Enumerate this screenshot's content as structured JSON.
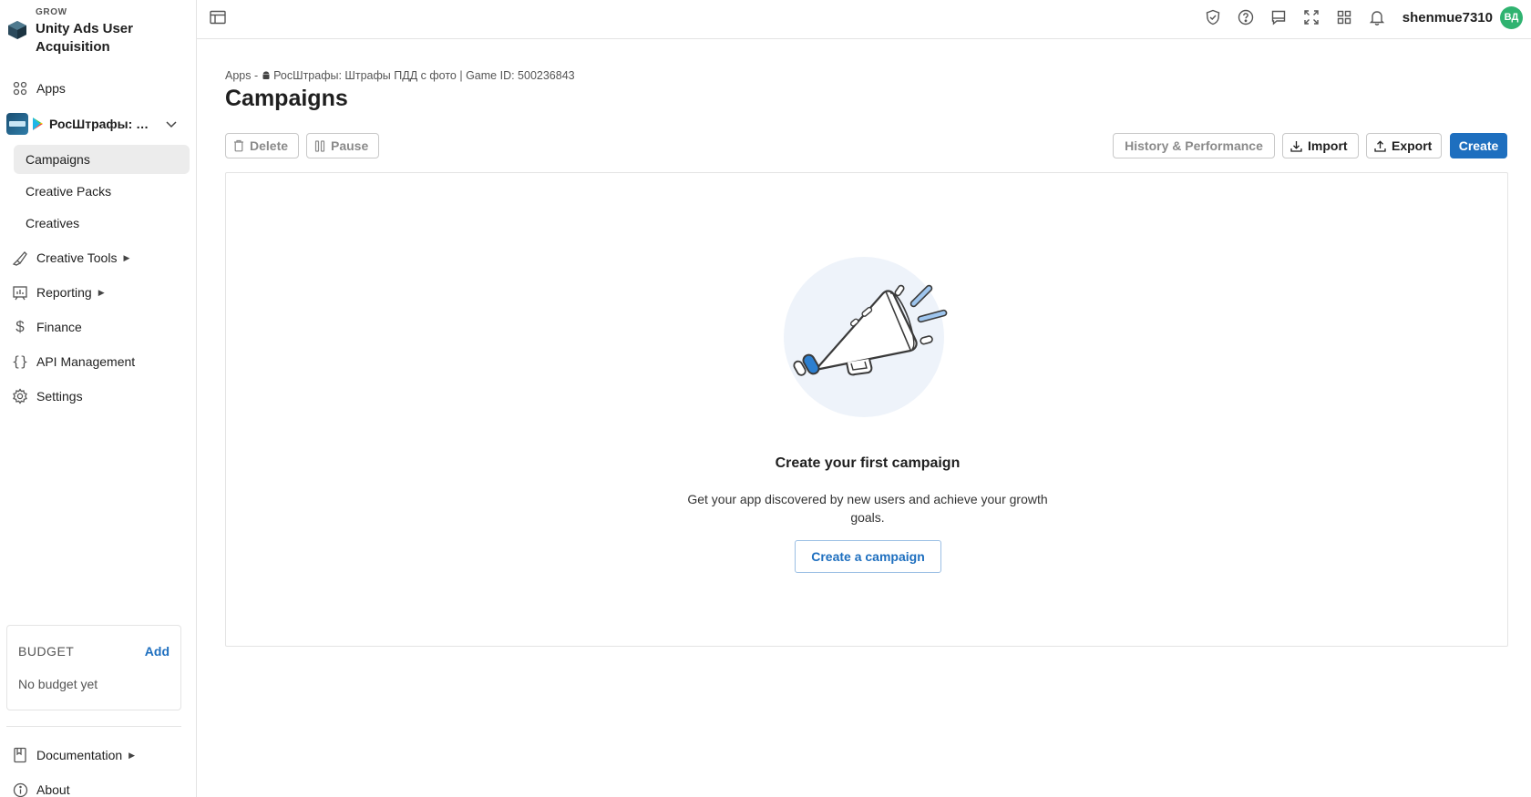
{
  "brand": {
    "eyebrow": "GROW",
    "title": "Unity Ads User Acquisition"
  },
  "sidebar": {
    "apps_label": "Apps",
    "app": {
      "name": "РосШтрафы: Штрафы ПДД с фото"
    },
    "sub_items": [
      {
        "label": "Campaigns",
        "active": true
      },
      {
        "label": "Creative Packs"
      },
      {
        "label": "Creatives"
      }
    ],
    "items": [
      {
        "label": "Creative Tools"
      },
      {
        "label": "Reporting"
      },
      {
        "label": "Finance"
      },
      {
        "label": "API Management"
      },
      {
        "label": "Settings"
      }
    ],
    "budget": {
      "title": "BUDGET",
      "add_label": "Add",
      "empty_text": "No budget yet"
    },
    "bottom_items": [
      {
        "label": "Documentation"
      },
      {
        "label": "About"
      }
    ]
  },
  "topbar": {
    "username": "shenmue7310",
    "avatar_initials": "ВД"
  },
  "main": {
    "breadcrumb": {
      "apps": "Apps",
      "separator": "-",
      "app_name": "РосШтрафы: Штрафы ПДД с фото",
      "divider": "|",
      "game_id": "Game ID: 500236843"
    },
    "title": "Campaigns",
    "toolbar": {
      "delete_label": "Delete",
      "pause_label": "Pause",
      "history_label": "History & Performance",
      "import_label": "Import",
      "export_label": "Export",
      "create_label": "Create"
    },
    "empty_state": {
      "title": "Create your first campaign",
      "description": "Get your app discovered by new users and achieve your growth goals.",
      "cta_label": "Create a campaign"
    }
  },
  "colors": {
    "accent": "#1e6fbf",
    "avatar": "#2fb370",
    "active_nav": "#ececec"
  }
}
